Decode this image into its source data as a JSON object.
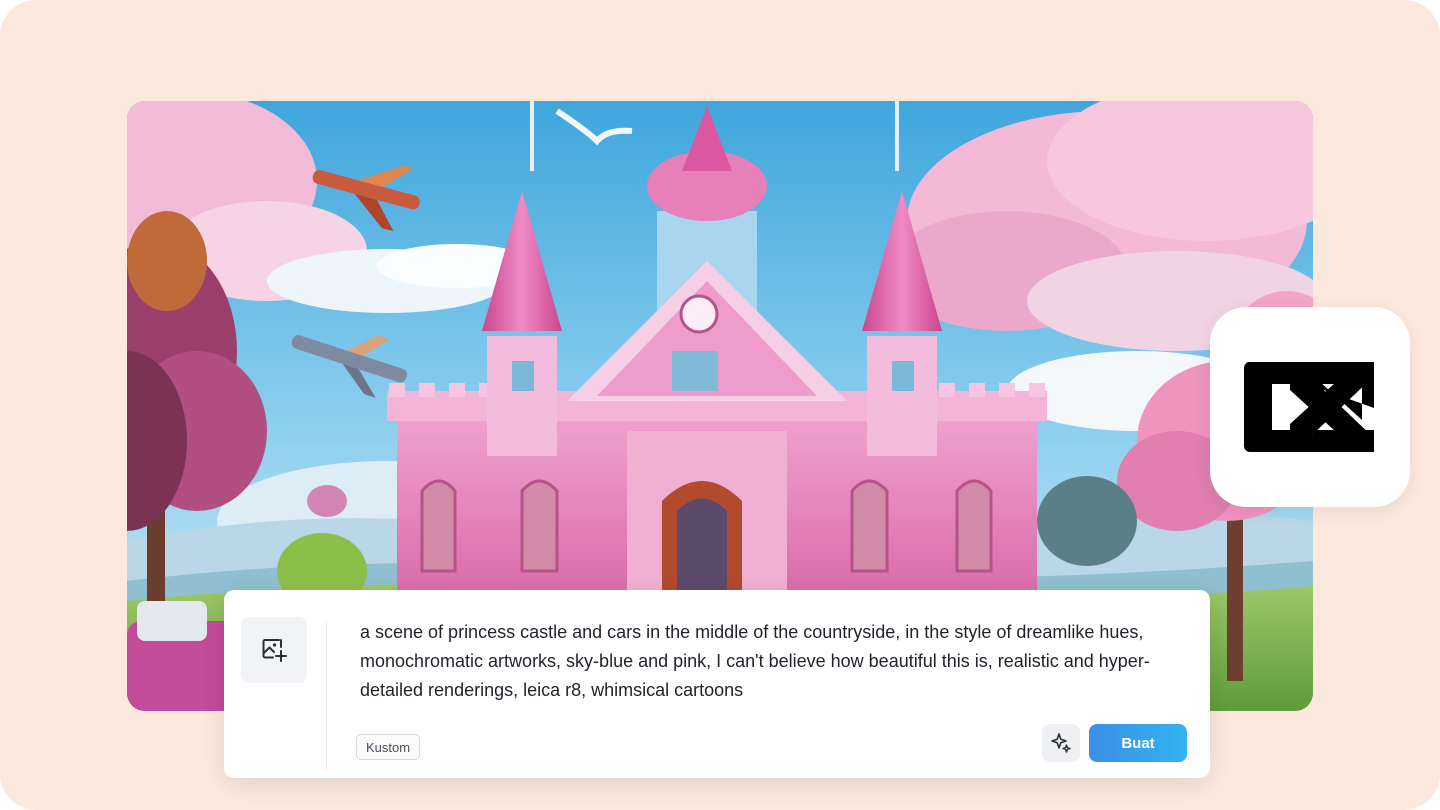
{
  "prompt": {
    "text": "a scene of princess castle and cars in the middle of the countryside, in the style of dreamlike hues, monochromatic artworks, sky-blue and pink, I can't believe how beautiful this is, realistic and hyper-detailed renderings, leica r8, whimsical cartoons",
    "style_tag": "Kustom",
    "create_label": "Buat"
  },
  "icons": {
    "upload": "image-add-icon",
    "magic": "sparkles-icon",
    "logo": "capcut-logo"
  },
  "colors": {
    "background": "#fde8de",
    "create_button_start": "#3a8fe6",
    "create_button_end": "#33b3ee",
    "castle_pink": "#e88ac0",
    "sky": "#5fb8e8"
  }
}
